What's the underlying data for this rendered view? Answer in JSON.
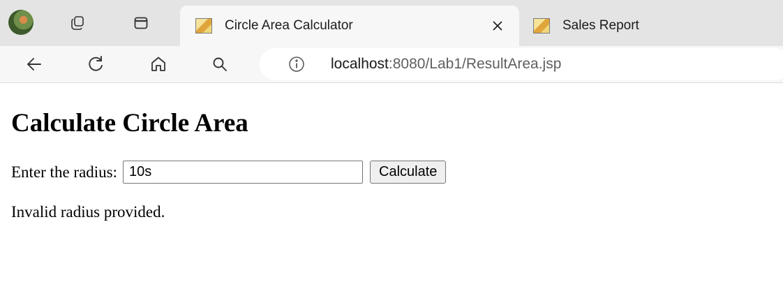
{
  "browser": {
    "tabs": [
      {
        "title": "Circle Area Calculator",
        "active": true,
        "icon": "tomcat-favicon-icon"
      },
      {
        "title": "Sales Report",
        "active": false,
        "icon": "tomcat-favicon-icon"
      }
    ],
    "address": {
      "host": "localhost",
      "path": ":8080/Lab1/ResultArea.jsp"
    }
  },
  "page": {
    "heading": "Calculate Circle Area",
    "radius_label": "Enter the radius:",
    "radius_value": "10s",
    "calculate_label": "Calculate",
    "message": "Invalid radius provided."
  },
  "colors": {
    "tabstrip_bg": "#e4e4e4",
    "toolbar_bg": "#f7f7f7",
    "button_bg": "#efefef"
  }
}
